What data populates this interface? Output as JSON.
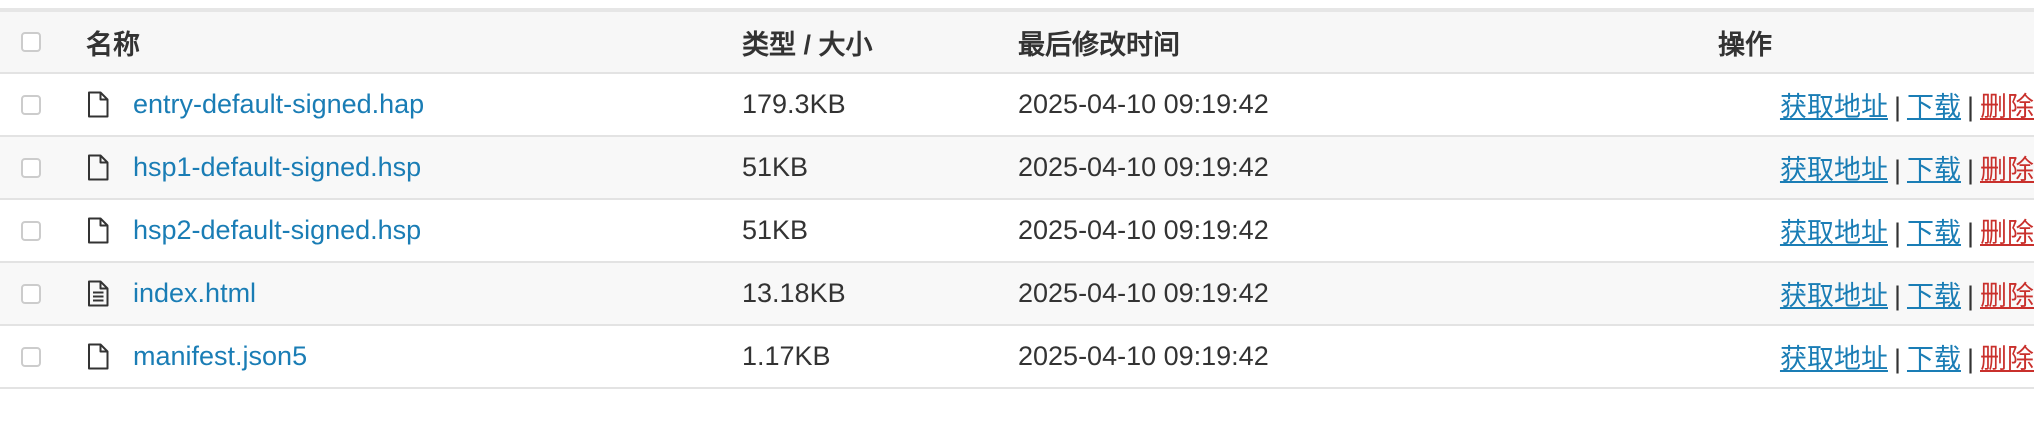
{
  "header": {
    "name": "名称",
    "type_size": "类型 / 大小",
    "modified": "最后修改时间",
    "actions": "操作"
  },
  "actions": {
    "get_url": "获取地址",
    "download": "下载",
    "delete": "删除",
    "separator": "|"
  },
  "files": [
    {
      "name": "entry-default-signed.hap",
      "size": "179.3KB",
      "modified": "2025-04-10 09:19:42",
      "icon": "file-icon"
    },
    {
      "name": "hsp1-default-signed.hsp",
      "size": "51KB",
      "modified": "2025-04-10 09:19:42",
      "icon": "file-icon"
    },
    {
      "name": "hsp2-default-signed.hsp",
      "size": "51KB",
      "modified": "2025-04-10 09:19:42",
      "icon": "file-icon"
    },
    {
      "name": "index.html",
      "size": "13.18KB",
      "modified": "2025-04-10 09:19:42",
      "icon": "file-text-icon"
    },
    {
      "name": "manifest.json5",
      "size": "1.17KB",
      "modified": "2025-04-10 09:19:42",
      "icon": "file-icon"
    }
  ],
  "colors": {
    "link": "#1a7db5",
    "delete": "#c9302c"
  }
}
